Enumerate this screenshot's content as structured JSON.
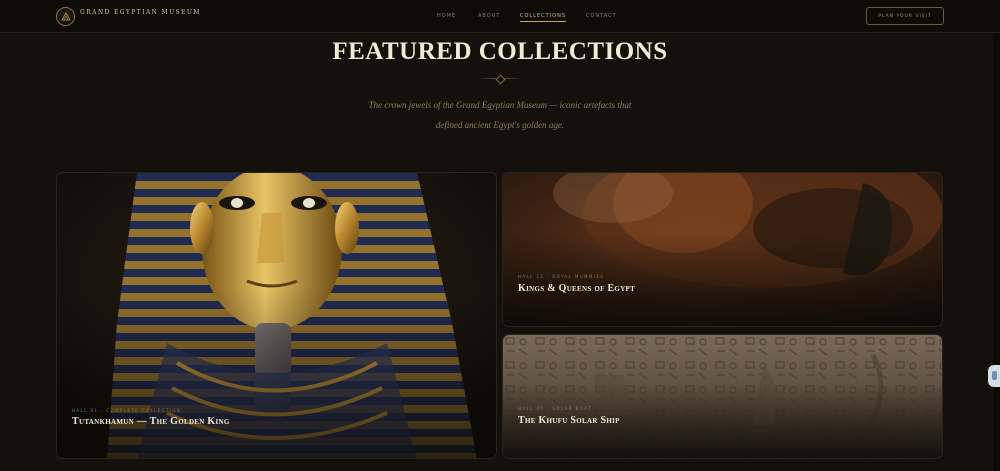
{
  "nav": {
    "brand": "Grand Egyptian Museum",
    "brand_sub": "",
    "links": [
      {
        "label": "Home"
      },
      {
        "label": "About"
      },
      {
        "label": "Collections",
        "active": true
      },
      {
        "label": "Contact"
      }
    ],
    "cta": "Plan Your Visit",
    "logo_icon": "museum-logo-icon"
  },
  "hero": {
    "title": "FEATURED COLLECTIONS",
    "subtitle": "The crown jewels of the Grand Egyptian Museum — iconic artefacts that defined ancient Egypt's golden age."
  },
  "cards": [
    {
      "tag": "Hall 01 · Complete Collection",
      "title": "Tutankhamun — The Golden King",
      "art": "golden-mask-image"
    },
    {
      "tag": "Hall 12 · Royal Mummies",
      "title": "Kings & Queens of Egypt",
      "art": "royal-mummy-image"
    },
    {
      "tag": "Hall 05 · Solar Boat",
      "title": "The Khufu Solar Ship",
      "art": "hieroglyph-relief-image"
    }
  ],
  "colors": {
    "background": "#14110c",
    "accent_gold": "#c9a45c",
    "text_light": "#f3ead3"
  }
}
